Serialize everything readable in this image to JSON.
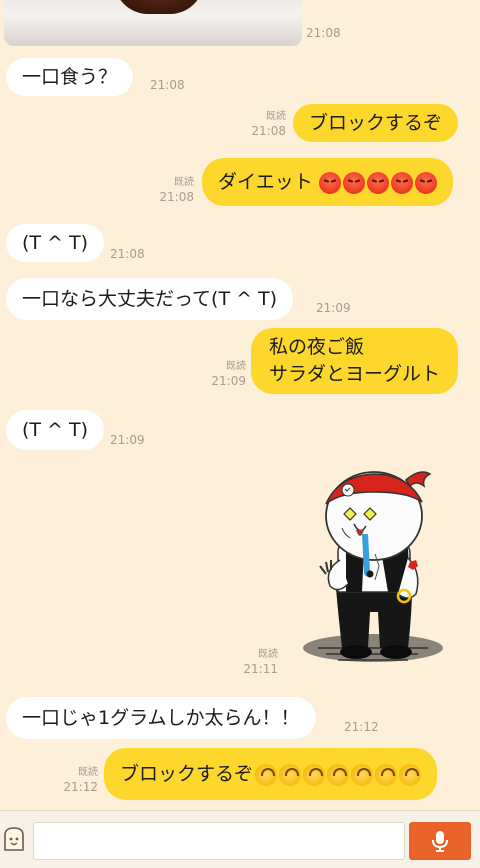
{
  "messages": [
    {
      "id": "m0",
      "time": "21:08"
    },
    {
      "id": "m1",
      "text": "一口食う？",
      "time": "21:08"
    },
    {
      "id": "m2",
      "text": "ブロックするぞ",
      "read": "既読",
      "time": "21:08"
    },
    {
      "id": "m3",
      "text": "ダイエット",
      "read": "既読",
      "time": "21:08",
      "emoji": "angry-face x5"
    },
    {
      "id": "m4",
      "text": "(T ^ T)",
      "time": "21:08"
    },
    {
      "id": "m5",
      "text": "一口なら大丈夫だって(T ^ T)",
      "time": "21:09"
    },
    {
      "id": "m6",
      "line1": "私の夜ご飯",
      "line2": "サラダとヨーグルト",
      "read": "既読",
      "time": "21:09"
    },
    {
      "id": "m7",
      "text": "(T ^ T)",
      "time": "21:09"
    },
    {
      "id": "m8",
      "read": "既読",
      "time": "21:11"
    },
    {
      "id": "m9",
      "text": "一口じゃ1グラムしか太らん！！",
      "time": "21:12"
    },
    {
      "id": "m10",
      "text": "ブロックするぞ",
      "read": "既読",
      "time": "21:12",
      "emoji": "upside-down-face x7"
    }
  ],
  "colors": {
    "background": "#fdefd8",
    "outgoing_bubble": "#fdd72c",
    "incoming_bubble": "#ffffff",
    "mic_button": "#e8622a"
  },
  "footer": {
    "input_value": "",
    "icons": [
      "toast-icon",
      "mic-icon"
    ]
  }
}
